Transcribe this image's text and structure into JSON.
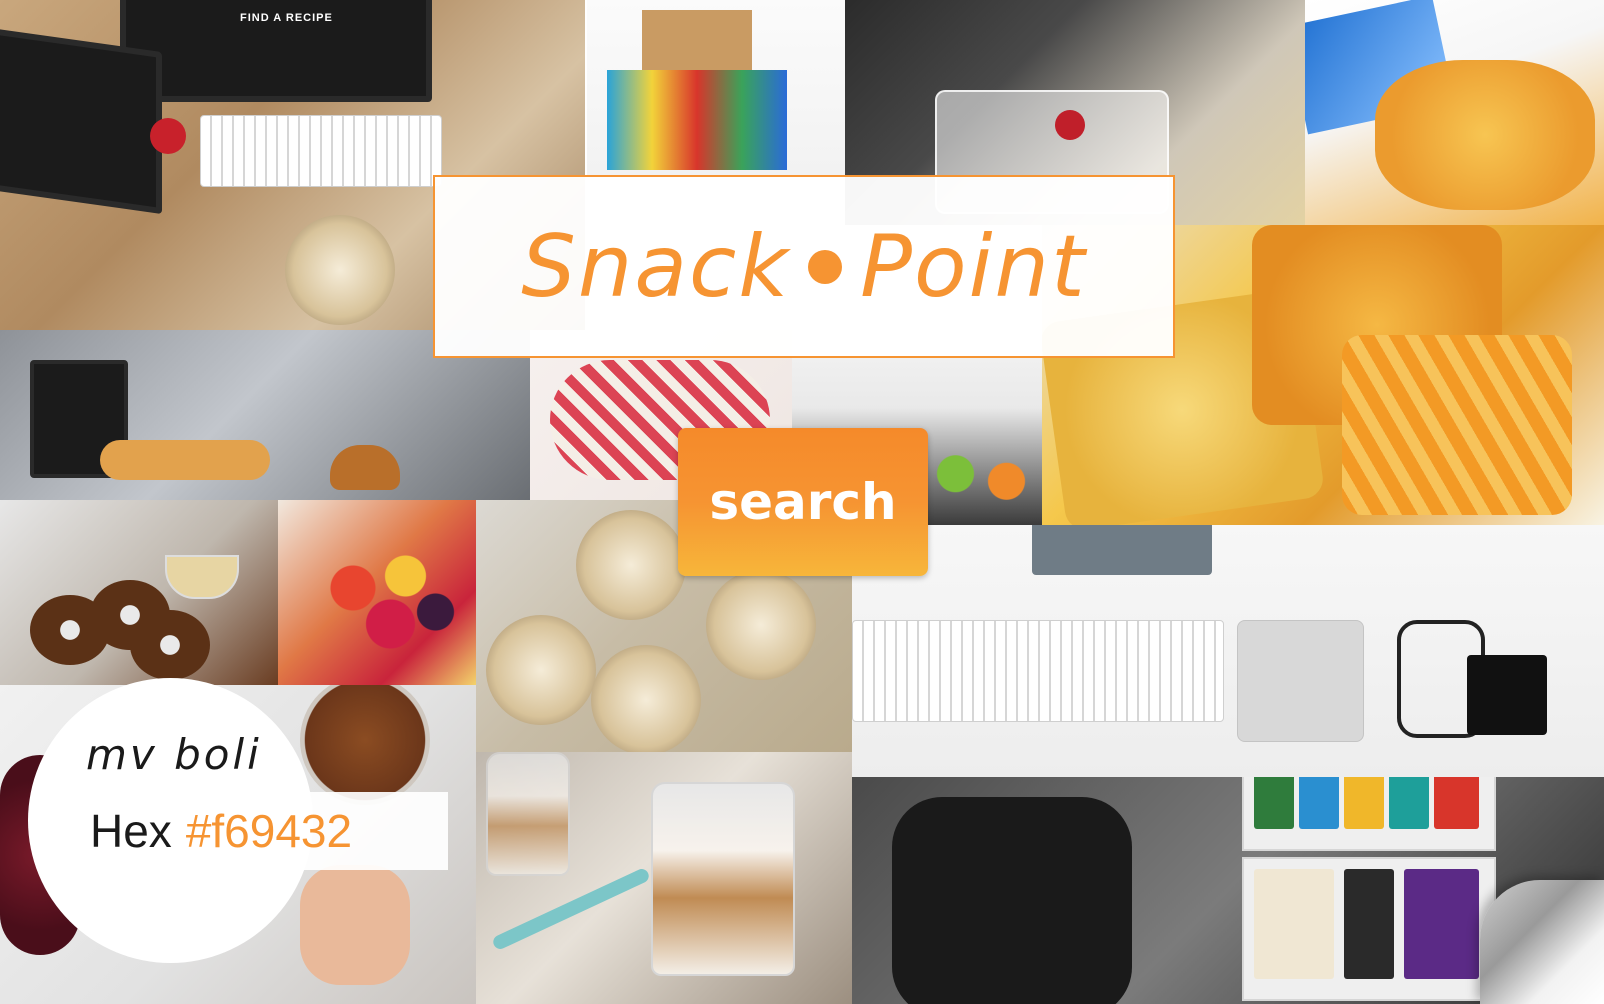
{
  "brand": {
    "word1": "Snack",
    "word2": "Point",
    "accent_color": "#f69432"
  },
  "actions": {
    "search_label": "search"
  },
  "font_info": {
    "font_name": "mv boli",
    "hex_label": "Hex",
    "hex_value": "#f69432"
  },
  "tiles": {
    "recipe_caption": "FIND A RECIPE"
  }
}
